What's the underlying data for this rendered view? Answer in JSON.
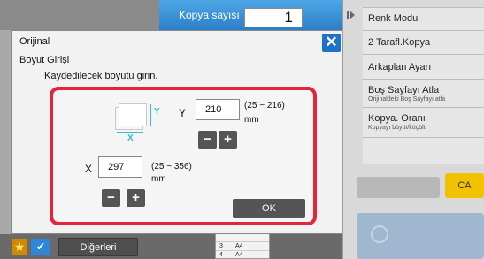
{
  "copies": {
    "label": "Kopya sayısı",
    "value": "1"
  },
  "right_panel": {
    "arrow_icon": "play-arrow-icon",
    "items": [
      {
        "label": "Renk Modu",
        "sub": ""
      },
      {
        "label": "2 Tarafl.Kopya",
        "sub": ""
      },
      {
        "label": "Arkaplan Ayarı",
        "sub": ""
      },
      {
        "label": "Boş Sayfayı Atla",
        "sub": "Orijinaldeki Boş Sayfayı atla"
      },
      {
        "label": "Kopya. Oranı",
        "sub": "Kopyayı büyüt/küçült"
      }
    ],
    "ca_label": "CA",
    "ca_color": "#f2c200"
  },
  "bottom_bar": {
    "others_label": "Diğerleri",
    "trays": [
      {
        "num": "3",
        "size": "A4"
      },
      {
        "num": "4",
        "size": "A4"
      }
    ]
  },
  "dialog": {
    "title": "Orijinal",
    "subtitle": "Boyut Girişi",
    "instruction": "Kaydedilecek boyutu girin.",
    "close_icon": "close-icon",
    "frame_color": "#e1253d",
    "illustration": {
      "y_label": "Y",
      "x_label": "X"
    },
    "y": {
      "label": "Y",
      "value": "210",
      "range": "(25 ~ 216)",
      "unit": "mm"
    },
    "x": {
      "label": "X",
      "value": "297",
      "range": "(25 ~ 356)",
      "unit": "mm"
    },
    "minus_label": "−",
    "plus_label": "+",
    "ok_label": "OK"
  }
}
